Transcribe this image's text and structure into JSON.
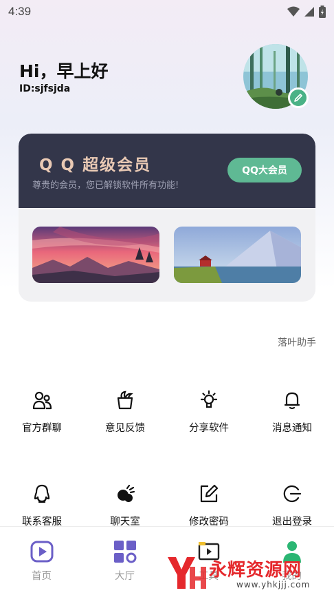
{
  "status_bar": {
    "time": "4:39"
  },
  "header": {
    "greeting": "Hi，早上好",
    "user_id": "ID:sjfsjdа"
  },
  "vip": {
    "title": "Q Q 超级会员",
    "subtitle": "尊贵的会员，您已解锁软件所有功能!",
    "button_label": "QQ大会员"
  },
  "helper": {
    "label": "落叶助手"
  },
  "grid": [
    {
      "label": "官方群聊",
      "icon": "group-icon"
    },
    {
      "label": "意见反馈",
      "icon": "feedback-icon"
    },
    {
      "label": "分享软件",
      "icon": "bulb-icon"
    },
    {
      "label": "消息通知",
      "icon": "bell-icon"
    },
    {
      "label": "联系客服",
      "icon": "qq-penguin-icon"
    },
    {
      "label": "聊天室",
      "icon": "chat-icon"
    },
    {
      "label": "修改密码",
      "icon": "edit-icon"
    },
    {
      "label": "退出登录",
      "icon": "logout-icon"
    }
  ],
  "bottom_nav": [
    {
      "label": "首页",
      "icon": "play-icon"
    },
    {
      "label": "大厅",
      "icon": "apps-icon"
    },
    {
      "label": "工具",
      "icon": "video-icon"
    },
    {
      "label": "我的",
      "icon": "person-icon"
    }
  ],
  "watermark": {
    "text": "永辉资源网",
    "url": "www.yhkjjj.com"
  },
  "colors": {
    "accent_green": "#4ab286",
    "vip_dark": "#33364a",
    "vip_gold": "#e9c9b4",
    "nav_purple": "#6b5fc7"
  }
}
